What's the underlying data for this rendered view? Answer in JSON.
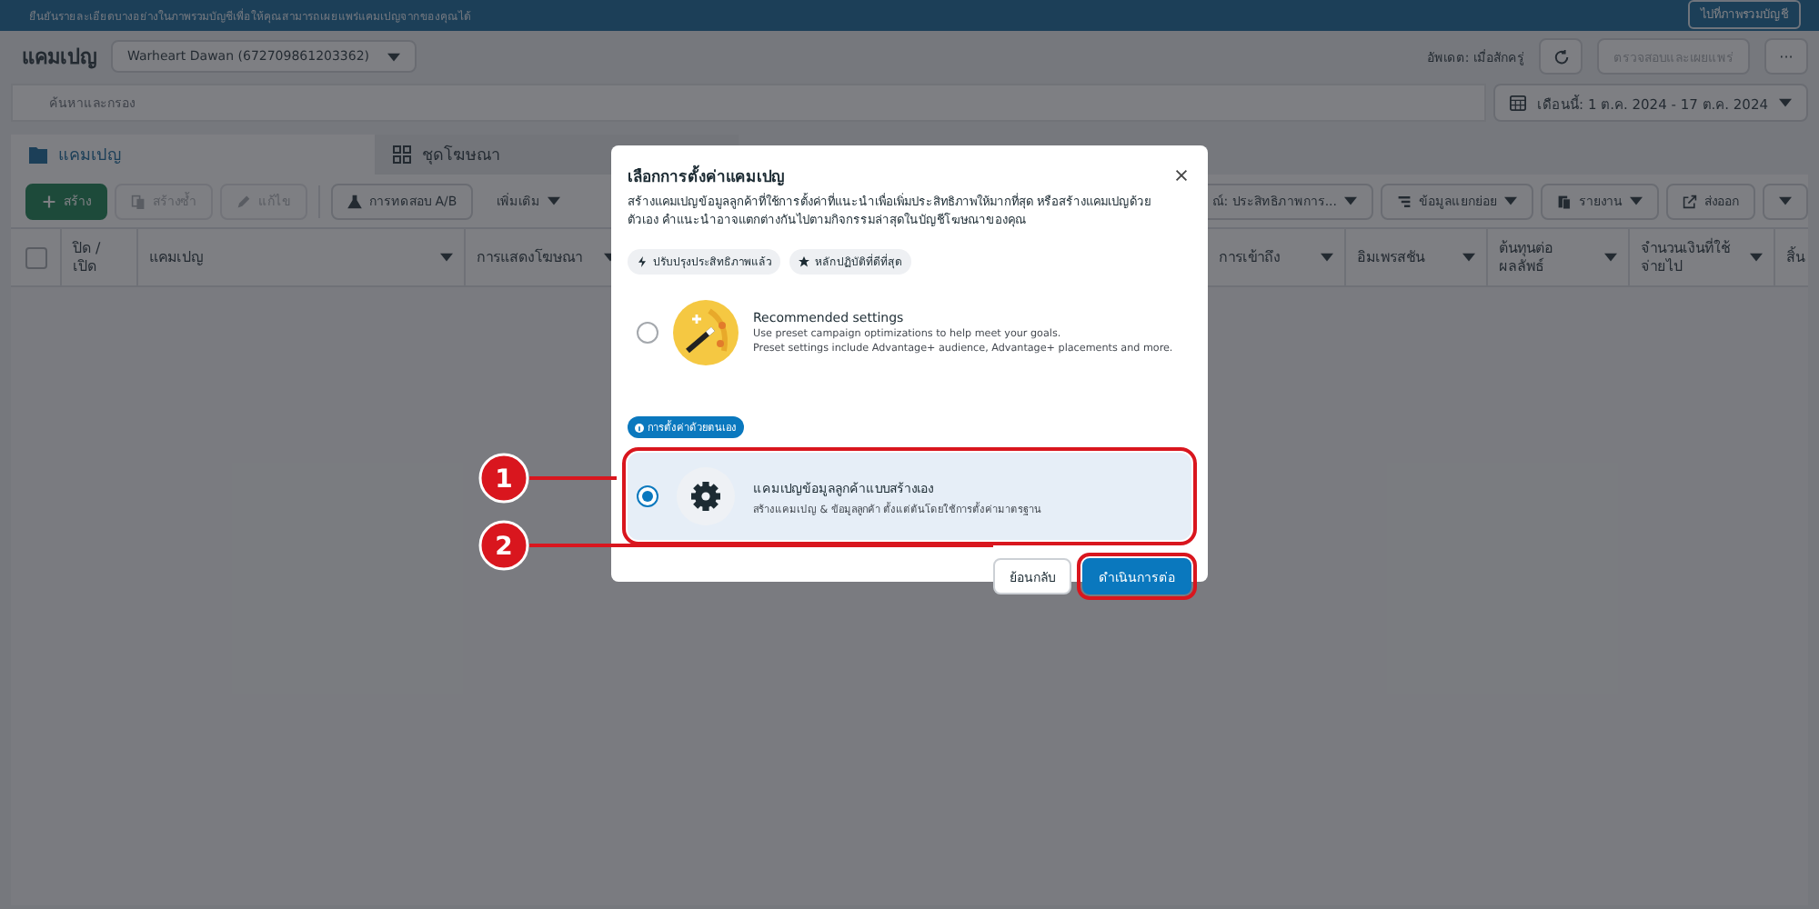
{
  "banner": {
    "message": "ยืนยันรายละเอียดบางอย่างในภาพรวมบัญชีเพื่อให้คุณสามารถเผยแพร่แคมเปญจากของคุณได้",
    "button": "ไปที่ภาพรวมบัญชี"
  },
  "header": {
    "title": "แคมเปญ",
    "account": "Warheart Dawan (672709861203362)",
    "updated": "อัพเดต: เมื่อสักครู่",
    "review_button": {
      "label": "ตรวจสอบและเผยแพร่",
      "disabled": true
    },
    "more_button": "···"
  },
  "filters": {
    "search_placeholder": "ค้นหาและกรอง",
    "date_range": "เดือนนี้: 1 ต.ค. 2024 - 17 ต.ค. 2024"
  },
  "tabs": [
    {
      "label": "แคมเปญ",
      "selected": true
    },
    {
      "label": "ชุดโฆษณา",
      "selected": false
    }
  ],
  "toolbar_left": [
    {
      "label": "สร้าง",
      "kind": "create",
      "disabled": false
    },
    {
      "label": "สร้างซ้ำ",
      "kind": "duplicate",
      "disabled": true
    },
    {
      "label": "แก้ไข",
      "kind": "edit",
      "disabled": true
    },
    {
      "label": "การทดสอบ A/B",
      "kind": "abtest",
      "disabled": false
    },
    {
      "label": "เพิ่มเติม",
      "kind": "more",
      "disabled": false
    }
  ],
  "toolbar_right": [
    {
      "label": "ณ์: ประสิทธิภาพการ...",
      "kind": "view"
    },
    {
      "label": "ข้อมูลแยกย่อย",
      "kind": "breakdown"
    },
    {
      "label": "รายงาน",
      "kind": "report"
    },
    {
      "label": "ส่งออก",
      "kind": "export"
    }
  ],
  "table": {
    "select_all": false,
    "columns": [
      {
        "label": "ปิด / เปิด",
        "sortable": false
      },
      {
        "label": "แคมเปญ",
        "sortable": true
      },
      {
        "label": "การแสดงโฆษณา",
        "sortable": true
      },
      {
        "label": "การเข้าถึง",
        "sortable": true
      },
      {
        "label": "อิมเพรสชัน",
        "sortable": true
      },
      {
        "label": "ต้นทุนต่อผลลัพธ์",
        "sortable": true
      },
      {
        "label": "จำนวนเงินที่ใช้จ่ายไป",
        "sortable": true
      },
      {
        "label": "สิ้น"
      }
    ]
  },
  "dialog": {
    "title": "เลือกการตั้งค่าแคมเปญ",
    "description": "สร้างแคมเปญข้อมูลลูกค้าที่ใช้การตั้งค่าที่แนะนำเพื่อเพิ่มประสิทธิภาพให้มากที่สุด หรือสร้างแคมเปญด้วยตัวเอง คำแนะนำอาจแตกต่างกันไปตามกิจกรรมล่าสุดในบัญชีโฆษณาของคุณ",
    "chips": [
      {
        "label": "ปรับปรุงประสิทธิภาพแล้ว",
        "kind": "bolt"
      },
      {
        "label": "หลักปฏิบัติที่ดีที่สุด",
        "kind": "star"
      }
    ],
    "options": [
      {
        "kind": "recommended",
        "title": "Recommended settings",
        "lines": [
          "Use preset campaign optimizations to help meet your goals.",
          "Preset settings include Advantage+ audience, Advantage+ placements and more."
        ],
        "selected": false,
        "highlighted": false
      },
      {
        "kind": "manual",
        "badge": "การตั้งค่าด้วยตนเอง",
        "title": "แคมเปญข้อมูลลูกค้าแบบสร้างเอง",
        "lines": [
          "สร้างแคมเปญ & ข้อมูลลูกค้า ตั้งแต่ต้นโดยใช้การตั้งค่ามาตรฐาน"
        ],
        "selected": true,
        "highlighted": true
      }
    ],
    "buttons": [
      {
        "label": "ย้อนกลับ",
        "kind": "secondary",
        "highlighted": false
      },
      {
        "label": "ดำเนินการต่อ",
        "kind": "primary",
        "highlighted": true
      }
    ]
  },
  "annotations": [
    {
      "number": "1"
    },
    {
      "number": "2"
    }
  ]
}
